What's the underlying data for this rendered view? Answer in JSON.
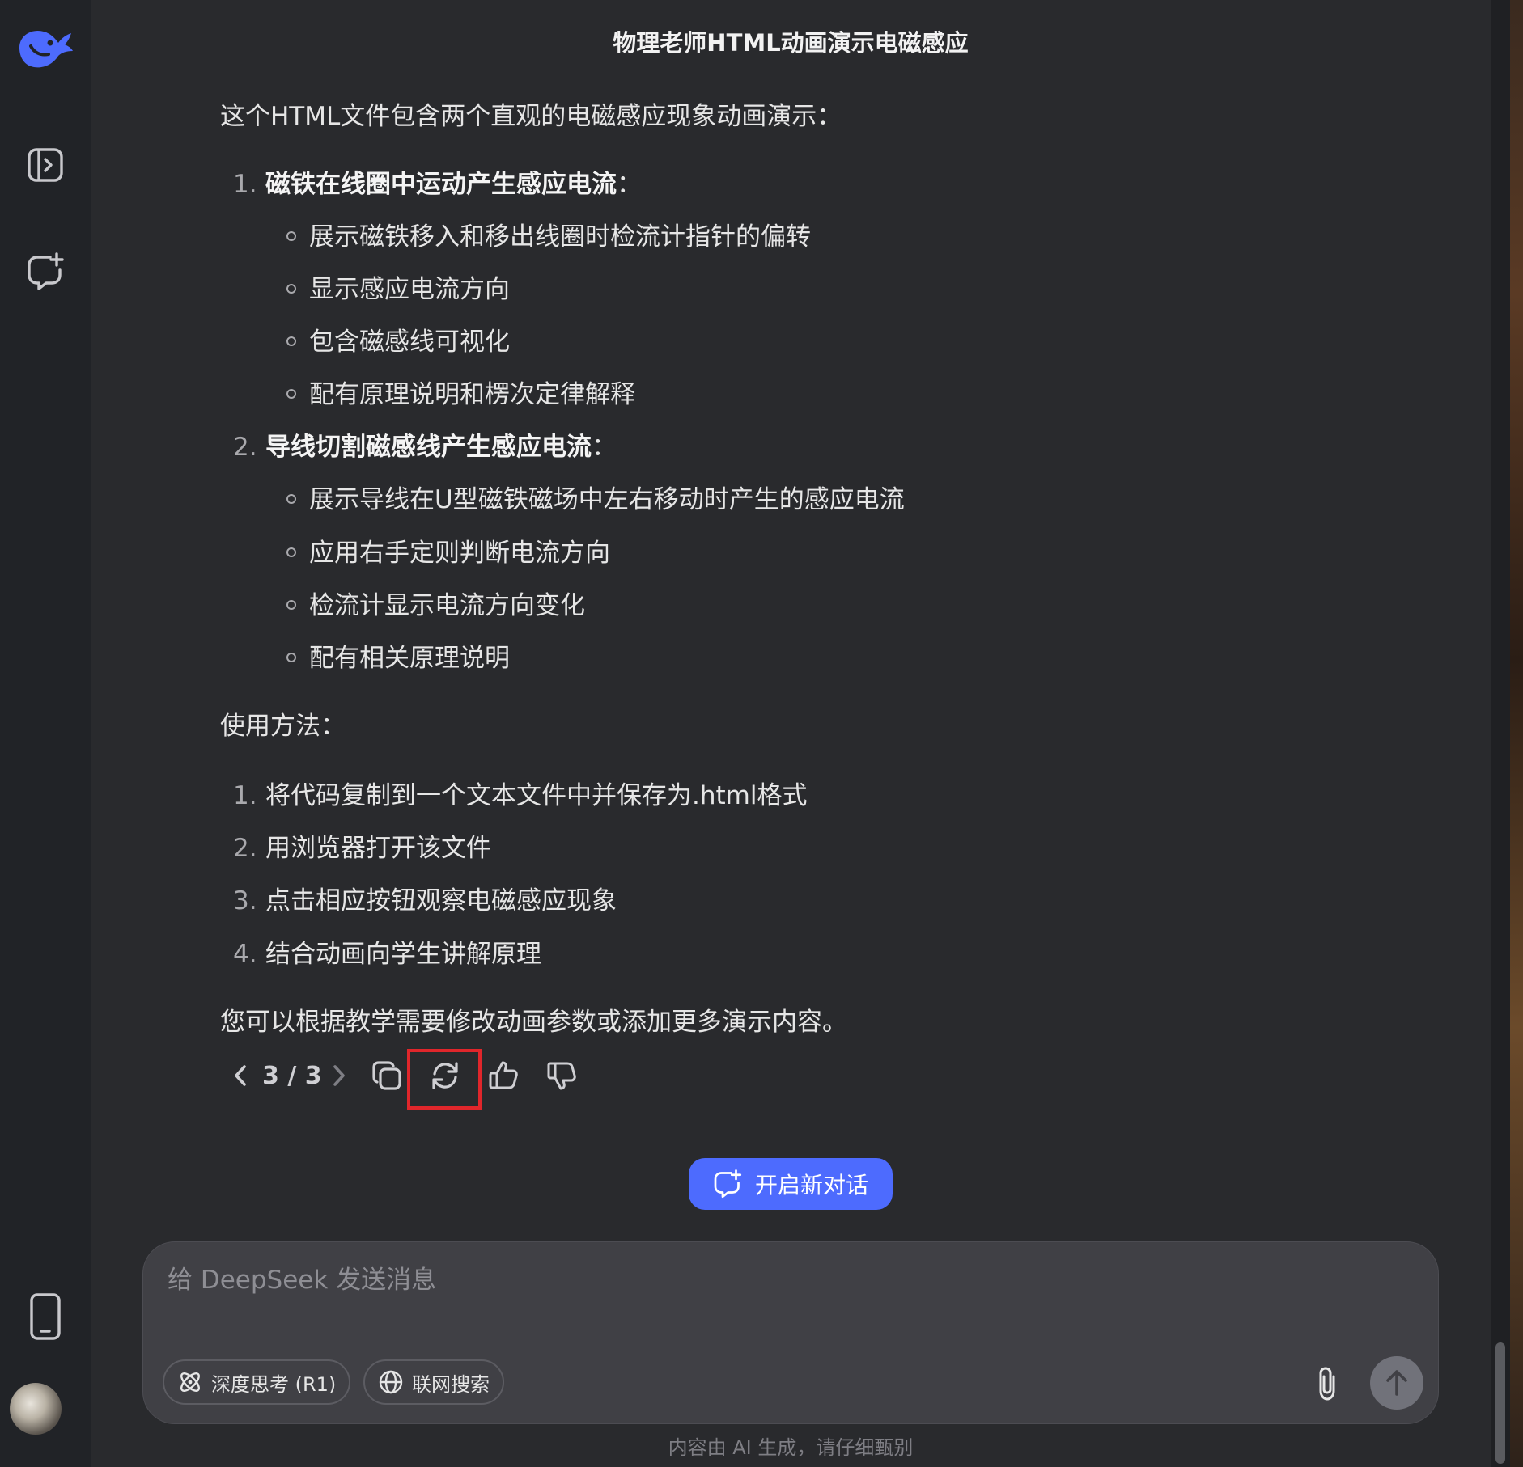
{
  "header": {
    "title": "物理老师HTML动画演示电磁感应"
  },
  "sidebar": {
    "icons": [
      "deepseek-logo-icon",
      "sidebar-toggle-icon",
      "new-chat-icon",
      "mobile-app-icon"
    ]
  },
  "message": {
    "intro": "这个HTML文件包含两个直观的电磁感应现象动画演示：",
    "sections": [
      {
        "num": "1.",
        "title": "磁铁在线圈中运动产生感应电流",
        "colon": "：",
        "bullets": [
          "展示磁铁移入和移出线圈时检流计指针的偏转",
          "显示感应电流方向",
          "包含磁感线可视化",
          "配有原理说明和楞次定律解释"
        ]
      },
      {
        "num": "2.",
        "title": "导线切割磁感线产生感应电流",
        "colon": "：",
        "bullets": [
          "展示导线在U型磁铁磁场中左右移动时产生的感应电流",
          "应用右手定则判断电流方向",
          "检流计显示电流方向变化",
          "配有相关原理说明"
        ]
      }
    ],
    "usage_heading": "使用方法：",
    "usage_steps": [
      {
        "num": "1.",
        "text": "将代码复制到一个文本文件中并保存为.html格式"
      },
      {
        "num": "2.",
        "text": "用浏览器打开该文件"
      },
      {
        "num": "3.",
        "text": "点击相应按钮观察电磁感应现象"
      },
      {
        "num": "4.",
        "text": "结合动画向学生讲解原理"
      }
    ],
    "closing": "您可以根据教学需要修改动画参数或添加更多演示内容。"
  },
  "actions": {
    "pager": "3 / 3"
  },
  "new_chat": {
    "label": "开启新对话"
  },
  "composer": {
    "placeholder": "给 DeepSeek 发送消息",
    "deep_think_label": "深度思考 (R1)",
    "web_search_label": "联网搜索"
  },
  "footer": {
    "note": "内容由 AI 生成，请仔细甄别"
  },
  "colors": {
    "accent": "#4d6bfe",
    "highlight": "#e0262b",
    "background": "#292a2d"
  }
}
